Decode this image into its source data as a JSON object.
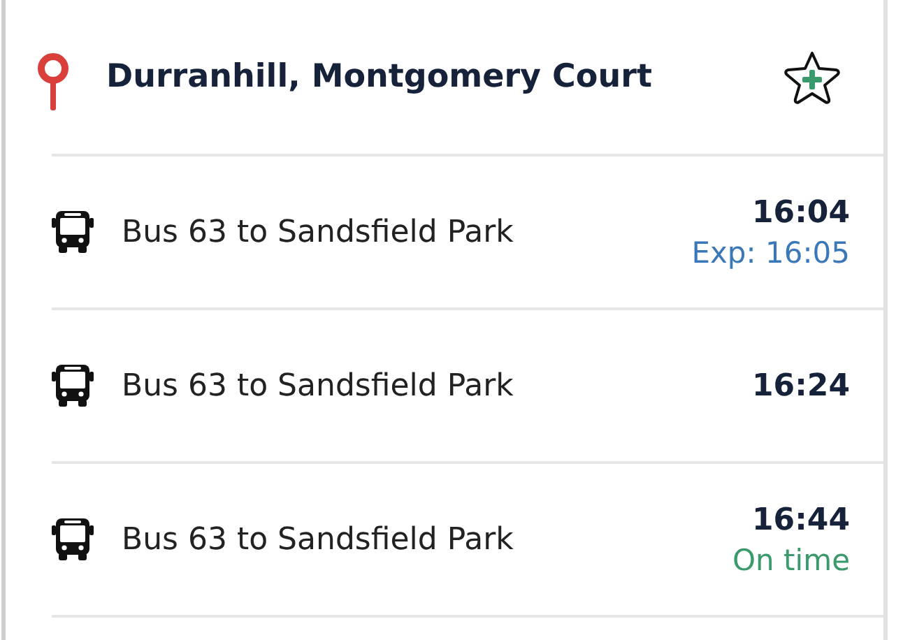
{
  "stop": {
    "name": "Durranhill, Montgomery Court"
  },
  "departures": [
    {
      "service": "Bus 63 to Sandsfield Park",
      "time": "16:04",
      "status": {
        "kind": "expected",
        "text": "Exp: 16:05"
      }
    },
    {
      "service": "Bus 63 to Sandsfield Park",
      "time": "16:24"
    },
    {
      "service": "Bus 63 to Sandsfield Park",
      "time": "16:44",
      "status": {
        "kind": "on_time",
        "text": "On time"
      }
    }
  ]
}
